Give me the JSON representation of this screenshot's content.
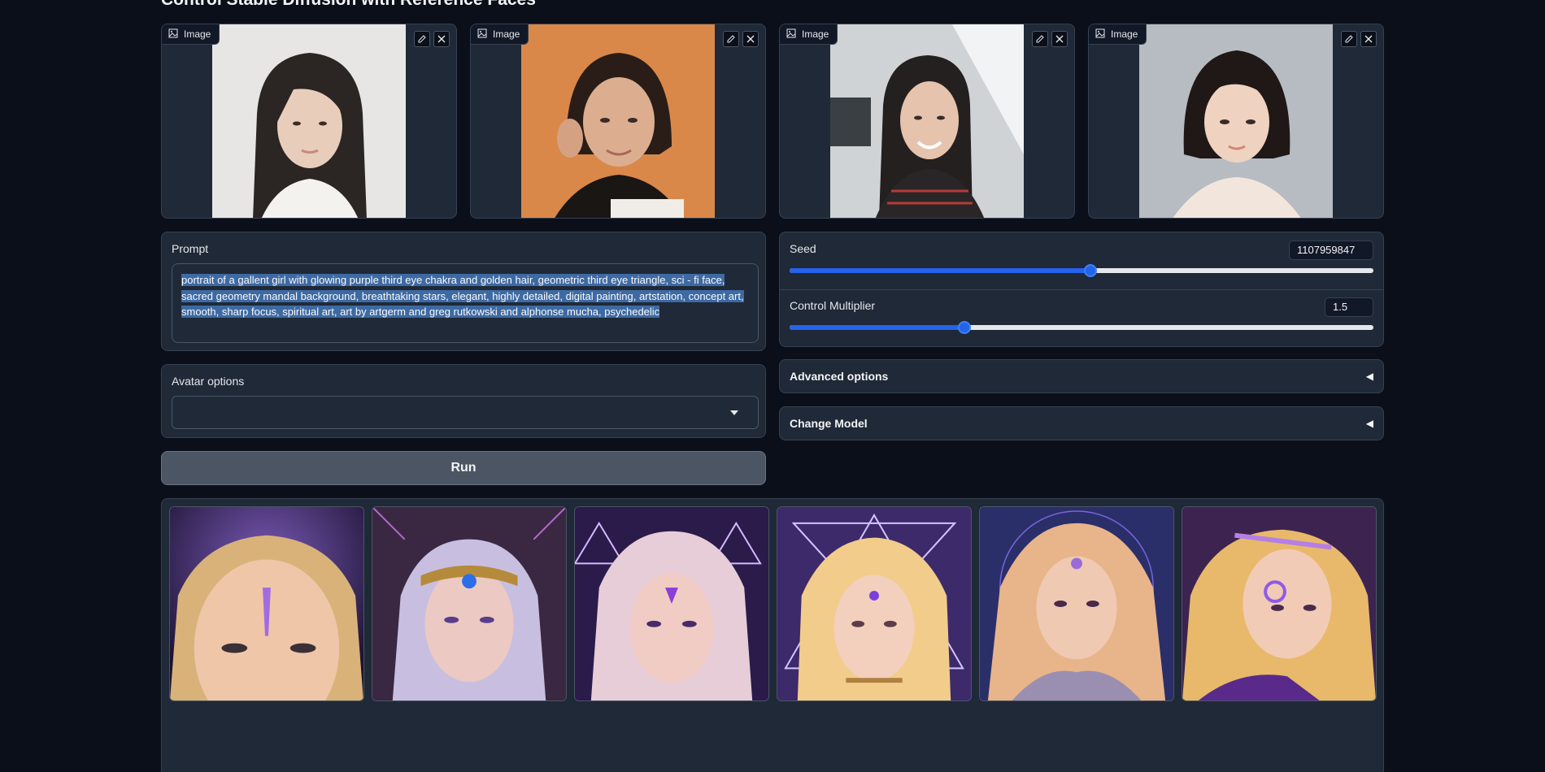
{
  "page": {
    "title": "Control Stable Diffusion with Reference Faces"
  },
  "reference_images": [
    {
      "label": "Image"
    },
    {
      "label": "Image"
    },
    {
      "label": "Image"
    },
    {
      "label": "Image"
    }
  ],
  "prompt": {
    "label": "Prompt",
    "value": "portrait of a gallent girl with glowing purple third eye chakra and golden hair, geometric third eye triangle, sci - fi face, sacred geometry mandal background, breathtaking stars, elegant, highly detailed, digital painting, artstation, concept art, smooth, sharp focus, spiritual art, art by artgerm and greg rutkowski and alphonse mucha, psychedelic"
  },
  "seed": {
    "label": "Seed",
    "value": "1107959847",
    "fraction": 0.516
  },
  "control_multiplier": {
    "label": "Control Multiplier",
    "value": "1.5",
    "fraction": 0.3
  },
  "avatar_options": {
    "label": "Avatar options",
    "value": ""
  },
  "advanced_options": {
    "label": "Advanced options",
    "arrow": "◀"
  },
  "change_model": {
    "label": "Change Model",
    "arrow": "◀"
  },
  "run_button": {
    "label": "Run"
  },
  "colors": {
    "accent": "#2563eb",
    "background": "#0b0f19",
    "panel": "#1f2937"
  }
}
